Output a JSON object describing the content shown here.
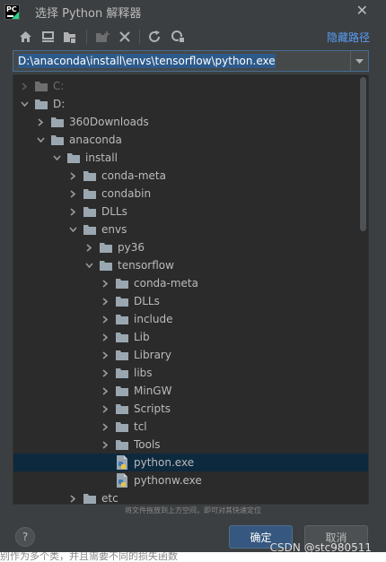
{
  "window": {
    "title": "选择 Python 解释器",
    "close_glyph": "✕"
  },
  "toolbar": {
    "hide_path_label": "隐藏路径",
    "icons": [
      "home-icon",
      "desktop-icon",
      "project-folder-icon",
      "new-folder-icon",
      "delete-icon",
      "refresh-icon",
      "show-hidden-icon"
    ]
  },
  "path_field": {
    "value": "D:\\anaconda\\install\\envs\\tensorflow\\python.exe"
  },
  "tree": {
    "rows": [
      {
        "label": "C:",
        "expanded": false,
        "dim": true
      },
      {
        "label": "D:",
        "expanded": true
      },
      {
        "label": "360Downloads",
        "expanded": false
      },
      {
        "label": "anaconda",
        "expanded": true
      },
      {
        "label": "install",
        "expanded": true
      },
      {
        "label": "conda-meta",
        "expanded": false
      },
      {
        "label": "condabin",
        "expanded": false
      },
      {
        "label": "DLLs",
        "expanded": false
      },
      {
        "label": "envs",
        "expanded": true
      },
      {
        "label": "py36",
        "expanded": false
      },
      {
        "label": "tensorflow",
        "expanded": true
      },
      {
        "label": "conda-meta",
        "expanded": false
      },
      {
        "label": "DLLs",
        "expanded": false
      },
      {
        "label": "include",
        "expanded": false
      },
      {
        "label": "Lib",
        "expanded": false
      },
      {
        "label": "Library",
        "expanded": false
      },
      {
        "label": "libs",
        "expanded": false
      },
      {
        "label": "MinGW",
        "expanded": false
      },
      {
        "label": "Scripts",
        "expanded": false
      },
      {
        "label": "tcl",
        "expanded": false
      },
      {
        "label": "Tools",
        "expanded": false
      },
      {
        "label": "python.exe",
        "selected": true
      },
      {
        "label": "pythonw.exe"
      },
      {
        "label": "etc",
        "expanded": false
      }
    ]
  },
  "hint_text": "将文件拖放到上方空间，即可对其快速定位",
  "buttons": {
    "help": "?",
    "ok": "确定",
    "cancel": "取消"
  },
  "watermark": "CSDN @stc980511",
  "below_text": "别作为多个类，并且需要不同的损失函数"
}
